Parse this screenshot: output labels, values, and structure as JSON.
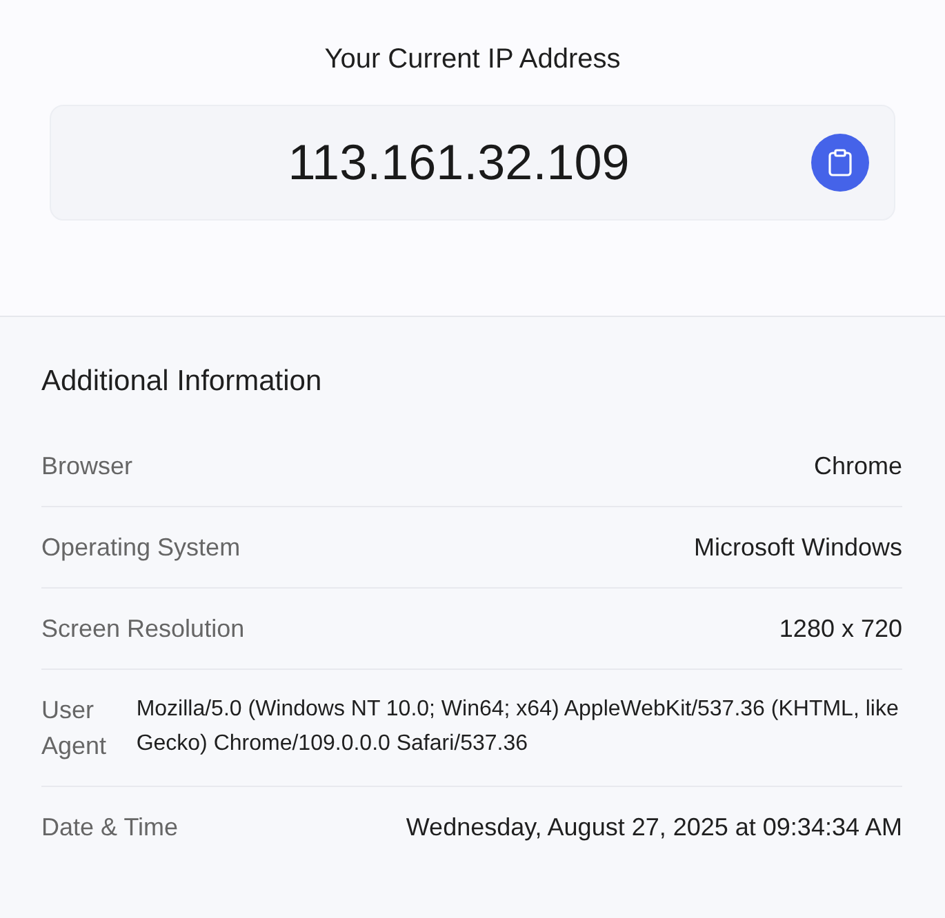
{
  "header": {
    "title": "Your Current IP Address"
  },
  "ip_card": {
    "address": "113.161.32.109"
  },
  "additional_info": {
    "title": "Additional Information",
    "rows": [
      {
        "kind": "plain",
        "label": "Browser",
        "value": "Chrome"
      },
      {
        "kind": "plain",
        "label": "Operating System",
        "value": "Microsoft Windows"
      },
      {
        "kind": "plain",
        "label": "Screen Resolution",
        "value": "1280 x 720"
      },
      {
        "kind": "wrapped",
        "label": "User Agent",
        "value": "Mozilla/5.0 (Windows NT 10.0; Win64; x64) AppleWebKit/537.36 (KHTML, like Gecko) Chrome/109.0.0.0 Safari/537.36"
      },
      {
        "kind": "plain",
        "label": "Date & Time",
        "value": "Wednesday, August 27, 2025 at 09:34:34 AM"
      }
    ]
  }
}
